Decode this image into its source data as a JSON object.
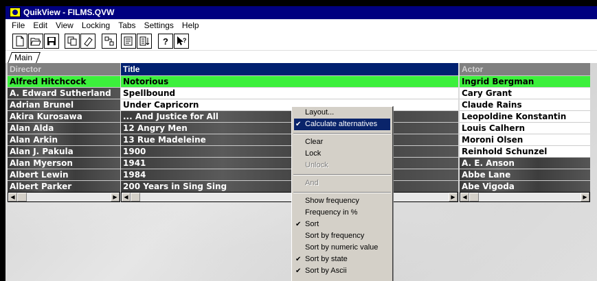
{
  "window": {
    "title": "QuikView - FILMS.QVW"
  },
  "menubar": [
    "File",
    "Edit",
    "View",
    "Locking",
    "Tabs",
    "Settings",
    "Help"
  ],
  "toolbar": {
    "icons": [
      "new-document-icon",
      "open-folder-icon",
      "save-icon",
      "copy-icon",
      "eraser-icon",
      "link-icon",
      "properties-icon",
      "sort-icon",
      "help-icon",
      "context-help-icon"
    ]
  },
  "tabs": [
    {
      "label": "Main"
    }
  ],
  "listboxes": {
    "director": {
      "header": "Director",
      "rows": [
        {
          "text": "Alfred Hitchcock",
          "state": "selected"
        },
        {
          "text": "A. Edward Sutherland",
          "state": "excluded"
        },
        {
          "text": "Adrian Brunel",
          "state": "excluded"
        },
        {
          "text": "Akira Kurosawa",
          "state": "excluded"
        },
        {
          "text": "Alan Alda",
          "state": "excluded"
        },
        {
          "text": "Alan Arkin",
          "state": "excluded"
        },
        {
          "text": "Alan J. Pakula",
          "state": "excluded"
        },
        {
          "text": "Alan Myerson",
          "state": "excluded"
        },
        {
          "text": "Albert Lewin",
          "state": "excluded"
        },
        {
          "text": "Albert Parker",
          "state": "excluded"
        }
      ]
    },
    "title": {
      "header": "Title",
      "rows": [
        {
          "text": "Notorious",
          "state": "selected"
        },
        {
          "text": "Spellbound",
          "state": "optional"
        },
        {
          "text": "Under Capricorn",
          "state": "optional"
        },
        {
          "text": "... And Justice for All",
          "state": "excluded"
        },
        {
          "text": "12 Angry Men",
          "state": "excluded"
        },
        {
          "text": "13 Rue Madeleine",
          "state": "excluded"
        },
        {
          "text": "1900",
          "state": "excluded"
        },
        {
          "text": "1941",
          "state": "excluded"
        },
        {
          "text": "1984",
          "state": "excluded"
        },
        {
          "text": "200 Years in Sing Sing",
          "state": "excluded"
        }
      ]
    },
    "actor": {
      "header": "Actor",
      "rows": [
        {
          "text": "Ingrid Bergman",
          "state": "selected"
        },
        {
          "text": "Cary Grant",
          "state": "optional"
        },
        {
          "text": "Claude Rains",
          "state": "optional"
        },
        {
          "text": "Leopoldine Konstantin",
          "state": "optional"
        },
        {
          "text": "Louis Calhern",
          "state": "optional"
        },
        {
          "text": "Moroni Olsen",
          "state": "optional"
        },
        {
          "text": "Reinhold Schunzel",
          "state": "optional"
        },
        {
          "text": "A. E. Anson",
          "state": "excluded"
        },
        {
          "text": "Abbe Lane",
          "state": "excluded"
        },
        {
          "text": "Abe Vigoda",
          "state": "excluded"
        }
      ]
    }
  },
  "context_menu": {
    "items": [
      {
        "label": "Layout...",
        "type": "item"
      },
      {
        "label": "Calculate alternatives",
        "type": "item",
        "checked": true,
        "highlighted": true
      },
      {
        "type": "separator"
      },
      {
        "label": "Clear",
        "type": "item"
      },
      {
        "label": "Lock",
        "type": "item"
      },
      {
        "label": "Unlock",
        "type": "item",
        "disabled": true
      },
      {
        "type": "separator"
      },
      {
        "label": "And",
        "type": "item",
        "disabled": true
      },
      {
        "type": "separator"
      },
      {
        "label": "Show frequency",
        "type": "item"
      },
      {
        "label": "Frequency in %",
        "type": "item"
      },
      {
        "label": "Sort",
        "type": "item",
        "checked": true
      },
      {
        "label": "Sort by frequency",
        "type": "item"
      },
      {
        "label": "Sort by numeric value",
        "type": "item"
      },
      {
        "label": "Sort by state",
        "type": "item",
        "checked": true
      },
      {
        "label": "Sort by Ascii",
        "type": "item",
        "checked": true
      }
    ]
  },
  "colors": {
    "selected": "#3cf03c",
    "optional": "#ffffff",
    "title_header": "#002070",
    "menu_highlight": "#0a246a"
  }
}
